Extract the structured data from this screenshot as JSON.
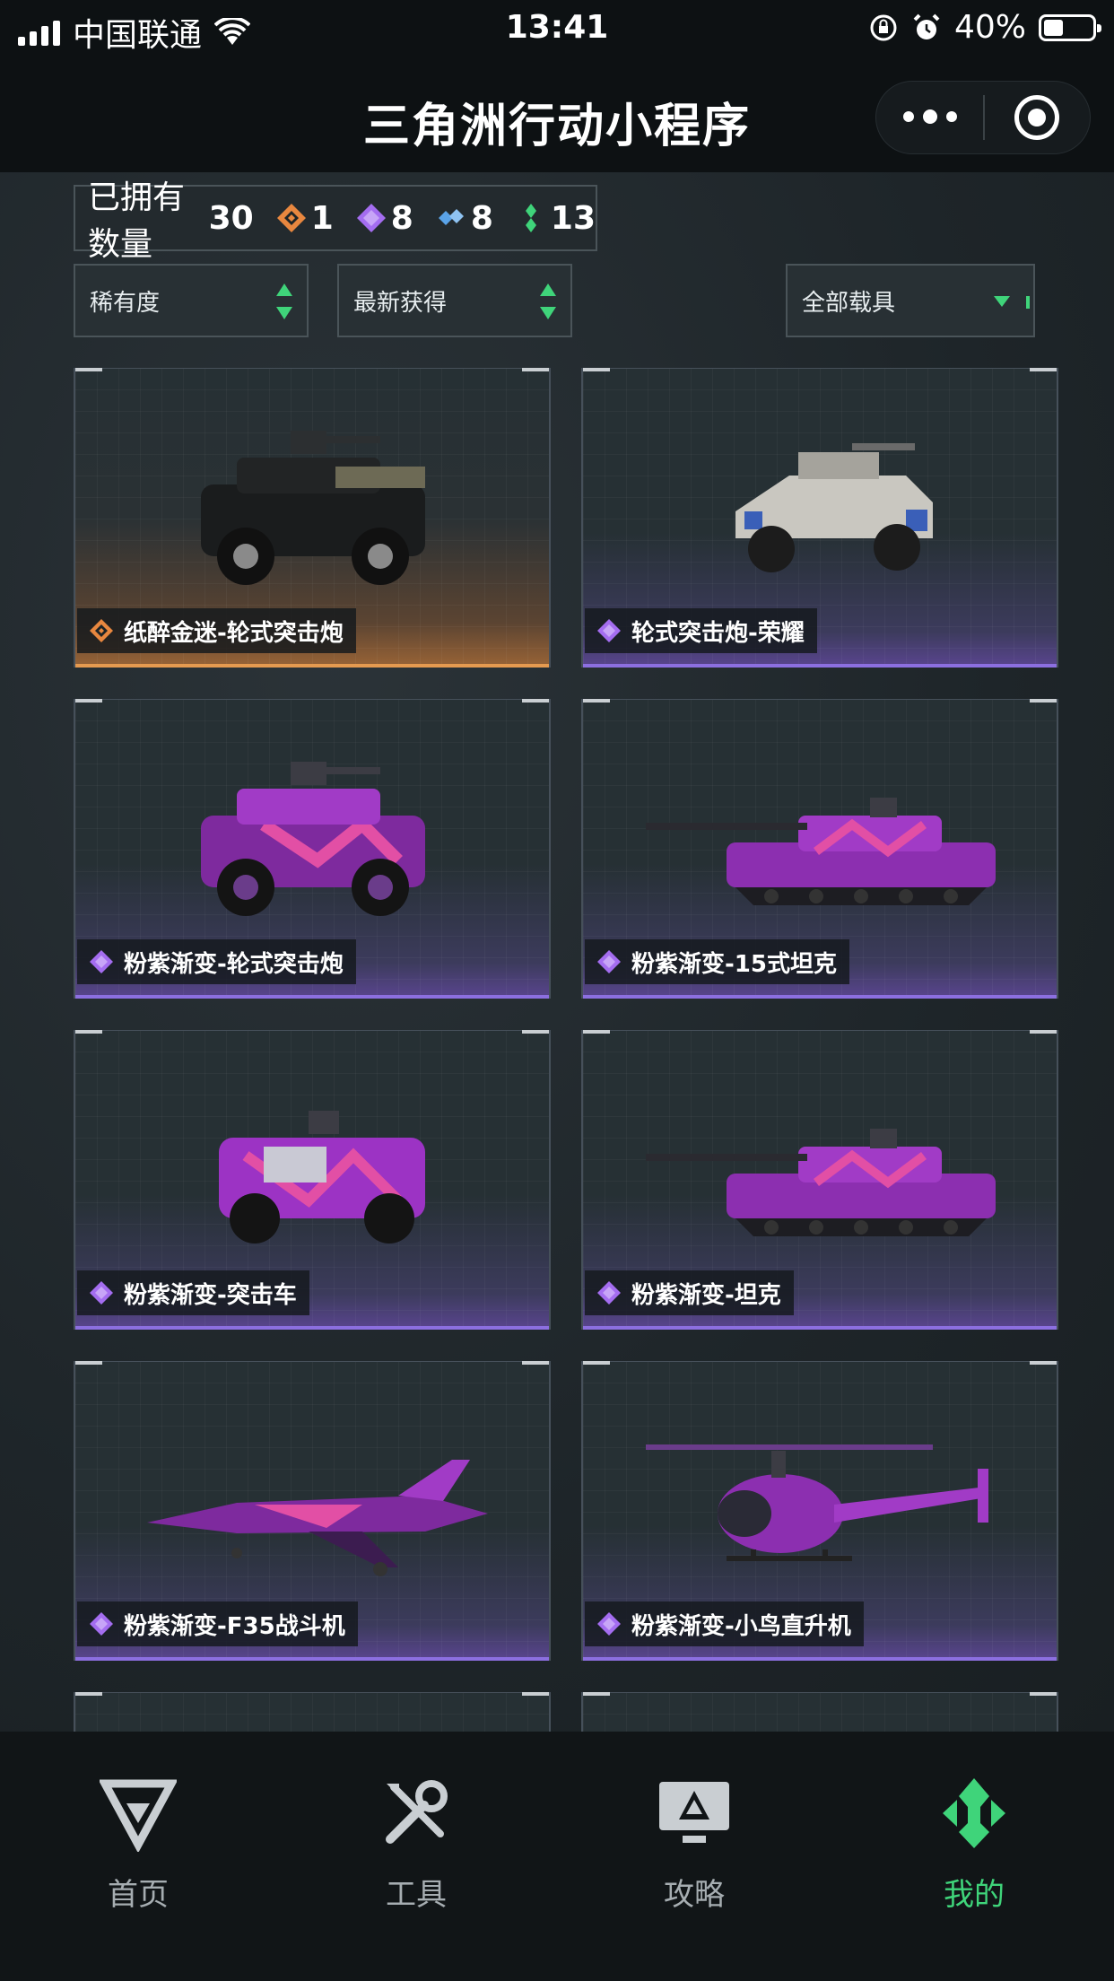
{
  "status_bar": {
    "carrier": "中国联通",
    "time": "13:41",
    "battery": "40%",
    "battery_level": 0.4,
    "icons": [
      "signal-icon",
      "wifi-icon",
      "orientation-lock-icon",
      "alarm-icon",
      "battery-icon"
    ]
  },
  "nav": {
    "title": "三角洲行动小程序",
    "icons": [
      "more-dots-icon",
      "close-target-icon"
    ]
  },
  "summary": {
    "label": "已拥有数量",
    "total": "30",
    "gems": [
      {
        "icon": "gold-gem-icon",
        "color": "#e8873f",
        "count": "1"
      },
      {
        "icon": "purple-gem-icon",
        "color": "#a46df0",
        "count": "8"
      },
      {
        "icon": "blue-gem-icon",
        "color": "#5aa3e8",
        "count": "8"
      },
      {
        "icon": "green-gem-icon",
        "color": "#3fd47a",
        "count": "13"
      }
    ]
  },
  "filters": {
    "rarity": "稀有度",
    "latest": "最新获得",
    "vehicles": "全部载具"
  },
  "cards": [
    {
      "name": "纸醉金迷-轮式突击炮",
      "rarity": "gold",
      "vehicle": "armored-car"
    },
    {
      "name": "轮式突击炮-荣耀",
      "rarity": "purple",
      "vehicle": "armored-car-white"
    },
    {
      "name": "粉紫渐变-轮式突击炮",
      "rarity": "purple",
      "vehicle": "armored-car-pink"
    },
    {
      "name": "粉紫渐变-15式坦克",
      "rarity": "purple",
      "vehicle": "tank"
    },
    {
      "name": "粉紫渐变-突击车",
      "rarity": "purple",
      "vehicle": "assault-vehicle"
    },
    {
      "name": "粉紫渐变-坦克",
      "rarity": "purple",
      "vehicle": "tank"
    },
    {
      "name": "粉紫渐变-F35战斗机",
      "rarity": "purple",
      "vehicle": "fighter-jet"
    },
    {
      "name": "粉紫渐变-小鸟直升机",
      "rarity": "purple",
      "vehicle": "helicopter"
    }
  ],
  "tabs": [
    {
      "label": "首页",
      "icon": "home-logo-icon",
      "active": false
    },
    {
      "label": "工具",
      "icon": "tools-icon",
      "active": false
    },
    {
      "label": "攻略",
      "icon": "guide-monitor-icon",
      "active": false
    },
    {
      "label": "我的",
      "icon": "profile-logo-icon",
      "active": true
    }
  ],
  "colors": {
    "accent_green": "#3fd47a",
    "purple_rarity": "#8c6fe0",
    "gold_rarity": "#e59a50"
  }
}
